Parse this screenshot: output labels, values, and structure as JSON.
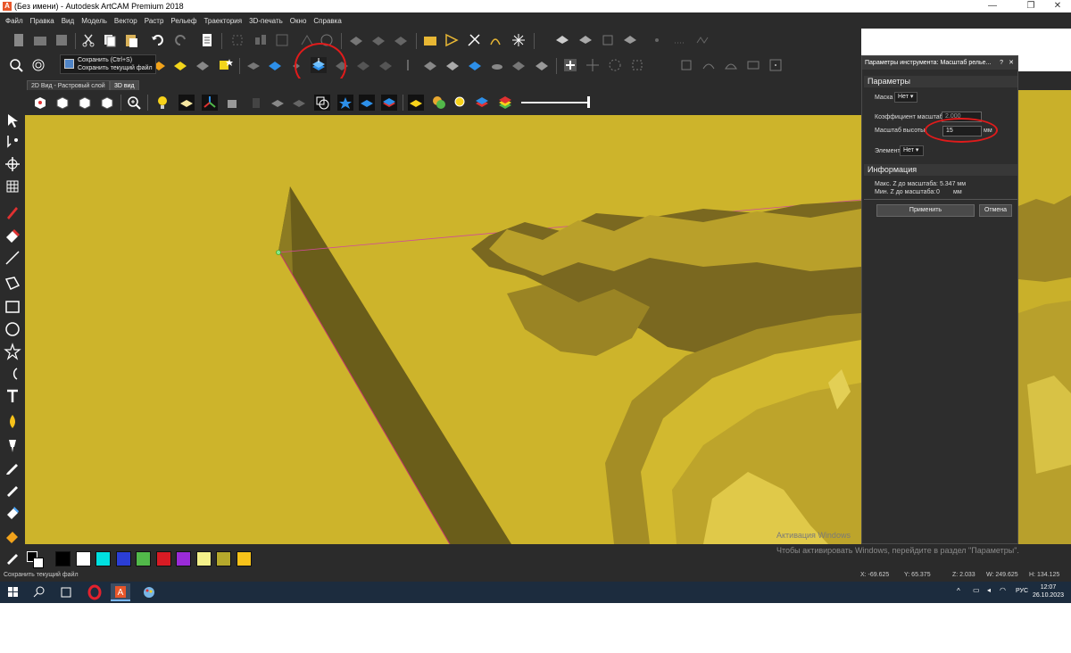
{
  "window": {
    "title": "(Без имени) - Autodesk ArtCAM Premium 2018",
    "app_icon_letter": "A",
    "minimize": "—",
    "maximize": "❐",
    "close": "✕"
  },
  "menu": [
    "Файл",
    "Правка",
    "Вид",
    "Модель",
    "Вектор",
    "Растр",
    "Рельеф",
    "Траектория",
    "3D-печать",
    "Окно",
    "Справка"
  ],
  "tooltip": {
    "line1": "Сохранить (Ctrl+S)",
    "line2": "Сохранить текущий файл"
  },
  "tabs": [
    "2D Вид - Растровый слой",
    "3D вид"
  ],
  "active_tab": "3D вид",
  "dialog": {
    "title": "Параметры инструмента: Масштаб релье...",
    "help": "?",
    "close": "✕",
    "section_params": "Параметры",
    "mask_label": "Маска",
    "mask_value": "Нет",
    "coef_label": "Коэффициент масштаба",
    "coef_value": "2.000",
    "height_label": "Масштаб высоты",
    "height_value": "15",
    "height_unit": "мм",
    "element_label": "Элемент",
    "element_value": "Нет",
    "section_info": "Информация",
    "max_z": "Макс. Z до масштаба: 5.347 мм",
    "min_z_label": "Мин. Z до масштаба:",
    "min_z_value": "0",
    "min_z_unit": "мм",
    "apply": "Применить",
    "cancel": "Отмена"
  },
  "palette_colors": [
    "#000000",
    "#ffffff",
    "#00e0e0",
    "#2b3ed6",
    "#52b94a",
    "#d81b24",
    "#9a2bd8",
    "#f4f08a",
    "#b5a82c",
    "#f7c21a"
  ],
  "watermark": {
    "line1": "Активация Windows",
    "line2": "Чтобы активировать Windows, перейдите в раздел \"Параметры\"."
  },
  "status": {
    "message": "Сохранить текущий файл",
    "x": "X: -69.625",
    "y": "Y: 65.375",
    "z": "Z: 2.033",
    "w": "W: 249.625",
    "h": "H: 134.125"
  },
  "taskbar": {
    "lang": "РУС",
    "time": "12:07",
    "date": "26.10.2023"
  },
  "colors": {
    "relief": "#cdb42b",
    "dark_ui": "#2b2b2b",
    "highlight_circle": "#e01b1b",
    "taskbar": "#1c2c3e"
  }
}
